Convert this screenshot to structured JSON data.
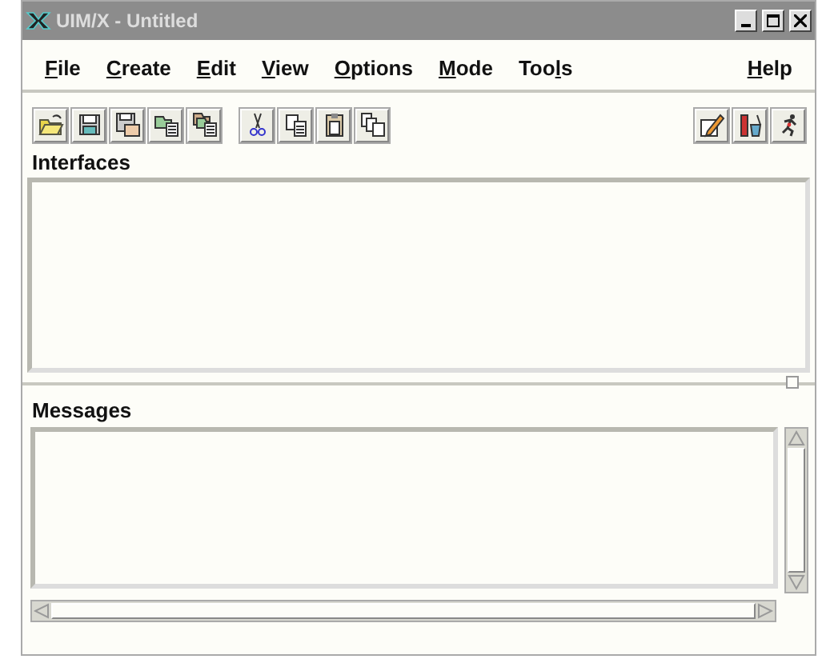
{
  "window": {
    "title": "UIM/X - Untitled"
  },
  "menu": [
    {
      "mnemonic": "F",
      "after": "ile"
    },
    {
      "mnemonic": "C",
      "after": "reate"
    },
    {
      "mnemonic": "E",
      "after": "dit"
    },
    {
      "mnemonic": "V",
      "after": "iew"
    },
    {
      "mnemonic": "O",
      "after": "ptions"
    },
    {
      "mnemonic": "M",
      "after": "ode"
    },
    {
      "before": "Too",
      "mnemonic": "l",
      "after": "s"
    },
    {
      "mnemonic": "H",
      "after": "elp"
    }
  ],
  "toolbar": [
    {
      "kind": "open"
    },
    {
      "kind": "save"
    },
    {
      "kind": "saveas"
    },
    {
      "kind": "import"
    },
    {
      "kind": "importall"
    },
    {
      "kind": "sep"
    },
    {
      "kind": "cut"
    },
    {
      "kind": "copy"
    },
    {
      "kind": "paste"
    },
    {
      "kind": "duplicate"
    },
    {
      "kind": "spacer"
    },
    {
      "kind": "edit"
    },
    {
      "kind": "test"
    },
    {
      "kind": "run"
    }
  ],
  "interfaces": {
    "label": "Interfaces"
  },
  "messages": {
    "label": "Messages"
  }
}
